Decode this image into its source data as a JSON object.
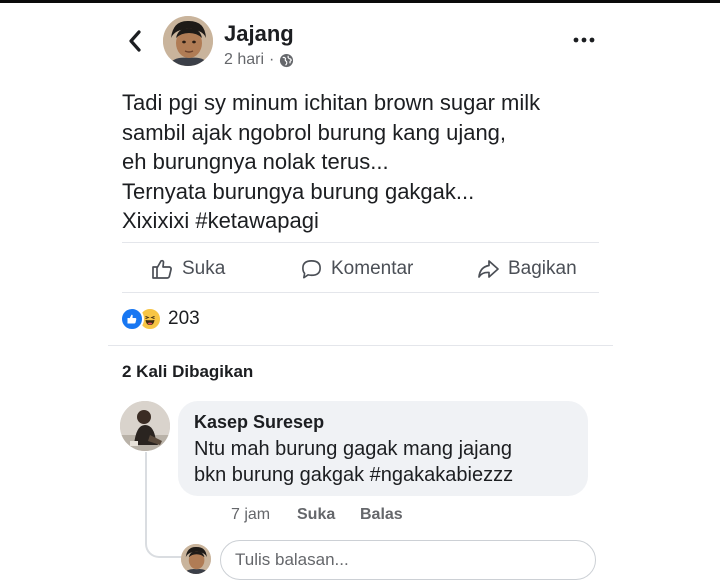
{
  "post": {
    "author": "Jajang",
    "time": "2 hari",
    "separator": "·",
    "privacy_icon": "globe-icon",
    "text_lines": [
      "Tadi pgi sy minum ichitan brown sugar milk",
      "sambil ajak ngobrol burung kang ujang,",
      "eh burungnya nolak terus...",
      "Ternyata burungya burung gakgak...",
      "Xixixixi #ketawapagi"
    ]
  },
  "actions": {
    "like": "Suka",
    "comment": "Komentar",
    "share": "Bagikan"
  },
  "reactions": {
    "icons": [
      "like-reaction-icon",
      "haha-reaction-icon"
    ],
    "count": "203"
  },
  "shares": {
    "label": "2 Kali Dibagikan"
  },
  "comment": {
    "author": "Kasep Suresep",
    "text_lines": [
      "Ntu mah burung gagak mang jajang",
      "bkn burung gakgak #ngakakabiezzz"
    ],
    "time": "7 jam",
    "like": "Suka",
    "reply": "Balas"
  },
  "reply_box": {
    "placeholder": "Tulis balasan..."
  },
  "colors": {
    "accent": "#1877f2",
    "haha": "#f7c545",
    "text": "#1c1e21",
    "secondary": "#65676b",
    "bubble": "#f0f2f5"
  }
}
